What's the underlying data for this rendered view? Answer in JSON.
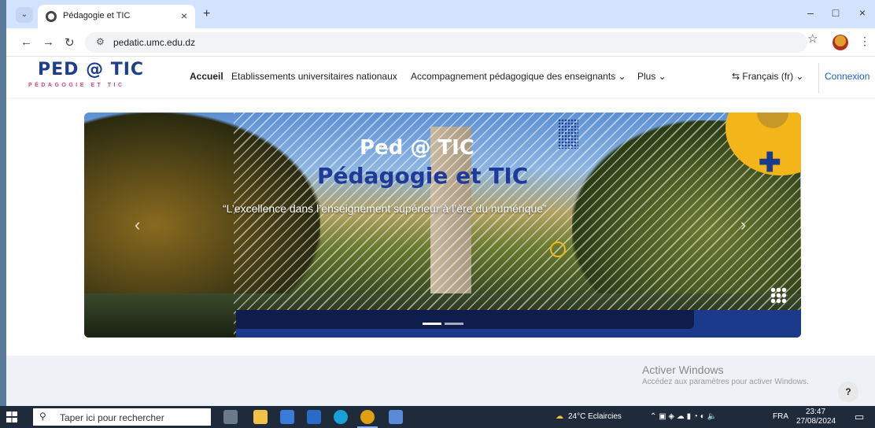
{
  "browser": {
    "tab_title": "Pédagogie et TIC",
    "tab_close": "×",
    "new_tab": "+",
    "url": "pedatic.umc.edu.dz",
    "minimize": "–",
    "maximize": "□",
    "close": "×"
  },
  "site": {
    "logo_main": "PED @ TIC",
    "logo_sub": "PÉDAGOGIE ET TIC",
    "nav": [
      {
        "label": "Accueil"
      },
      {
        "label": "Etablissements universitaires nationaux"
      },
      {
        "label": "Accompagnement pédagogique des enseignants ⌄"
      },
      {
        "label": "Plus ⌄"
      }
    ],
    "language": "Français (fr) ⌄",
    "login": "Connexion"
  },
  "carousel": {
    "title1": "Ped @ TIC",
    "title2": "Pédagogie et TIC",
    "tagline": "“L’excellence dans l’enseignement supérieur à l’ère du numérique”",
    "prev": "‹",
    "next": "›",
    "slide_count": 2,
    "active_slide": 1
  },
  "windows_watermark": {
    "title": "Activer Windows",
    "subtitle": "Accédez aux paramètres pour activer Windows."
  },
  "help_button": "?",
  "taskbar": {
    "search_placeholder": "Taper ici pour rechercher",
    "weather": "24°C  Eclaircies",
    "language": "FRA",
    "time": "23:47",
    "date": "27/08/2024"
  },
  "colors": {
    "brand_blue": "#1e3d8c",
    "accent_yellow": "#f2b51a",
    "link_blue": "#1b5fc4",
    "tab_strip": "#d3e3fd"
  }
}
